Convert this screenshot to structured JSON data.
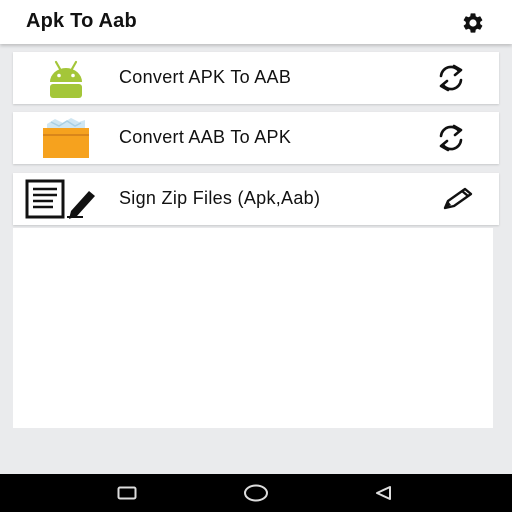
{
  "appbar": {
    "title": "Apk To Aab",
    "settings_icon": "gear-icon"
  },
  "options": [
    {
      "label": "Convert APK To AAB",
      "icon": "android-icon",
      "action_icon": "sync-icon"
    },
    {
      "label": "Convert AAB To APK",
      "icon": "box-icon",
      "action_icon": "sync-icon"
    },
    {
      "label": "Sign Zip Files (Apk,Aab)",
      "icon": "document-sign-icon",
      "action_icon": "pencil-icon"
    }
  ],
  "navbar": {
    "buttons": [
      "recents-icon",
      "home-icon",
      "back-icon"
    ]
  },
  "colors": {
    "android_green": "#a4c639",
    "box_orange": "#f6a21e",
    "background": "#eaebed",
    "navbar": "#000000"
  }
}
